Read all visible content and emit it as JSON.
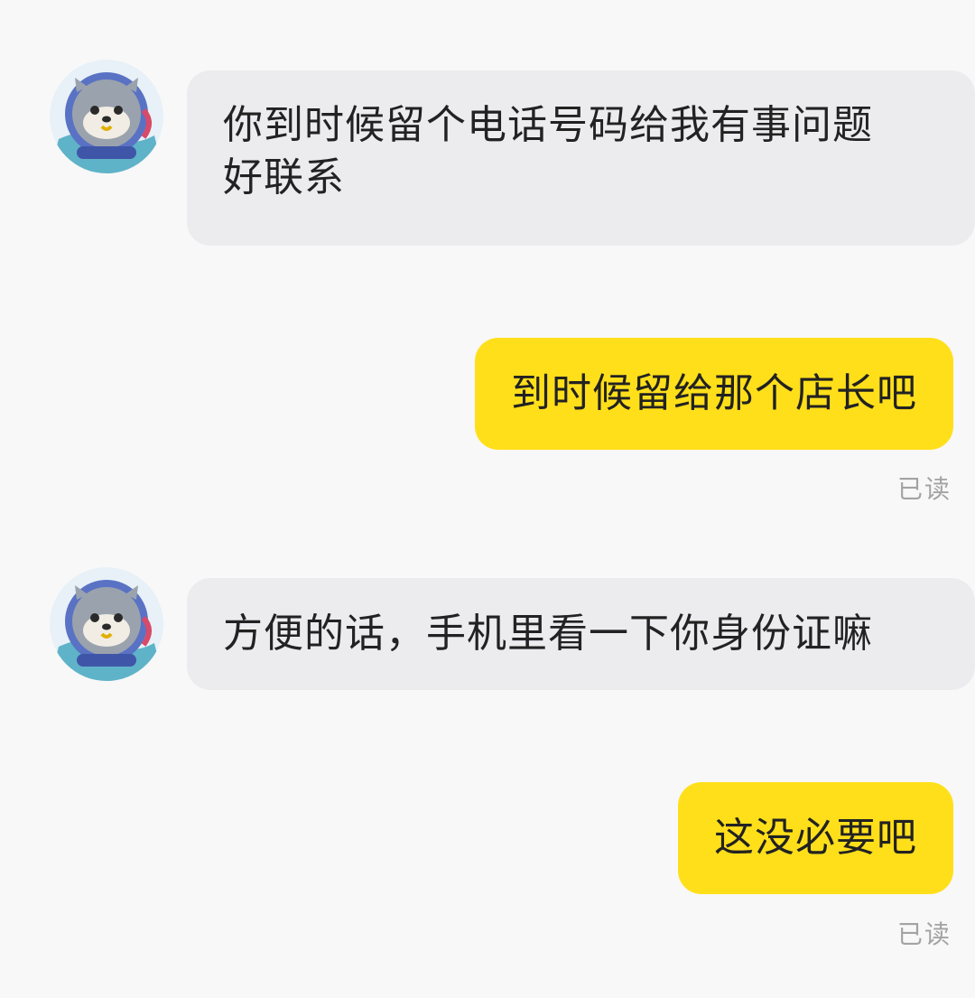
{
  "messages": [
    {
      "direction": "incoming",
      "text": "你到时候留个电话号码给我有事问题好联系",
      "line1": "你到时候留个电话号码给我有事问题",
      "line2": "好联系"
    },
    {
      "direction": "outgoing",
      "text": "到时候留给那个店长吧",
      "status": "已读"
    },
    {
      "direction": "incoming",
      "text": "方便的话，手机里看一下你身份证嘛"
    },
    {
      "direction": "outgoing",
      "text": "这没必要吧",
      "status": "已读"
    }
  ],
  "avatar": {
    "icon": "seal-astronaut-icon"
  },
  "colors": {
    "incoming_bubble": "#ececef",
    "outgoing_bubble": "#ffdf1a",
    "background": "#f8f8f8",
    "read_status": "#a3a3a3"
  }
}
